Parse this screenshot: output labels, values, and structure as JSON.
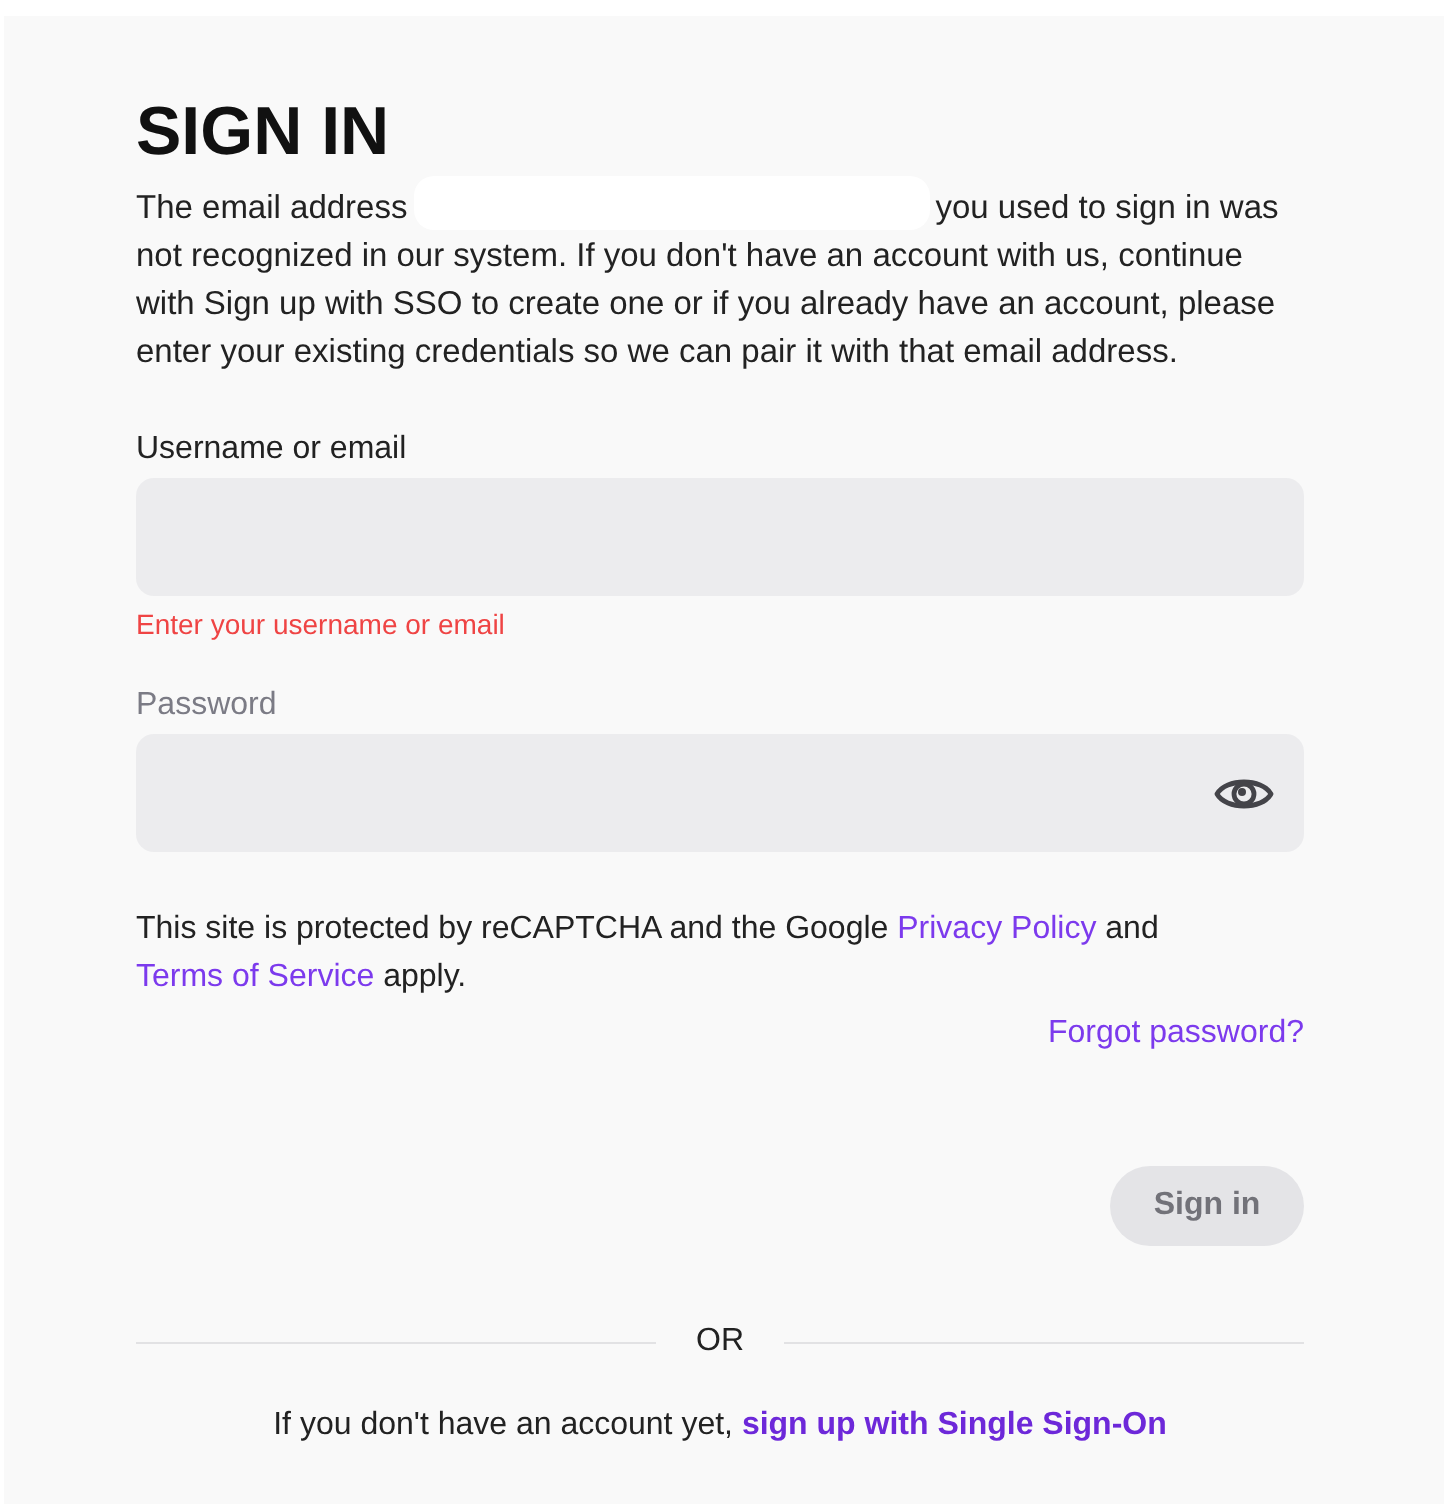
{
  "heading": "SIGN IN",
  "intro": {
    "before": "The email address",
    "redacted": true,
    "after": "you used to sign in was not recognized in our system. If you don't have an account with us, continue with Sign up with SSO to create one or if you already have an account, please enter your existing credentials so we can pair it with that email address."
  },
  "fields": [
    {
      "kind": "text",
      "label": "Username or email",
      "disabled": false,
      "error": "Enter your username or email"
    },
    {
      "kind": "password",
      "label": "Password",
      "disabled": true
    }
  ],
  "recaptcha_notice": [
    {
      "kind": "text",
      "text": "This site is protected by reCAPTCHA and the Google "
    },
    {
      "kind": "link",
      "text": "Privacy Policy"
    },
    {
      "kind": "text",
      "text": " and "
    },
    {
      "kind": "link",
      "text": "Terms of Service"
    },
    {
      "kind": "text",
      "text": " apply."
    }
  ],
  "forgot_password": "Forgot password?",
  "submit": {
    "label": "Sign in",
    "disabled": true
  },
  "divider": "OR",
  "signup": [
    {
      "kind": "text",
      "text": "If you don't have an account yet, "
    },
    {
      "kind": "link",
      "text": "sign up with Single Sign-On"
    }
  ]
}
